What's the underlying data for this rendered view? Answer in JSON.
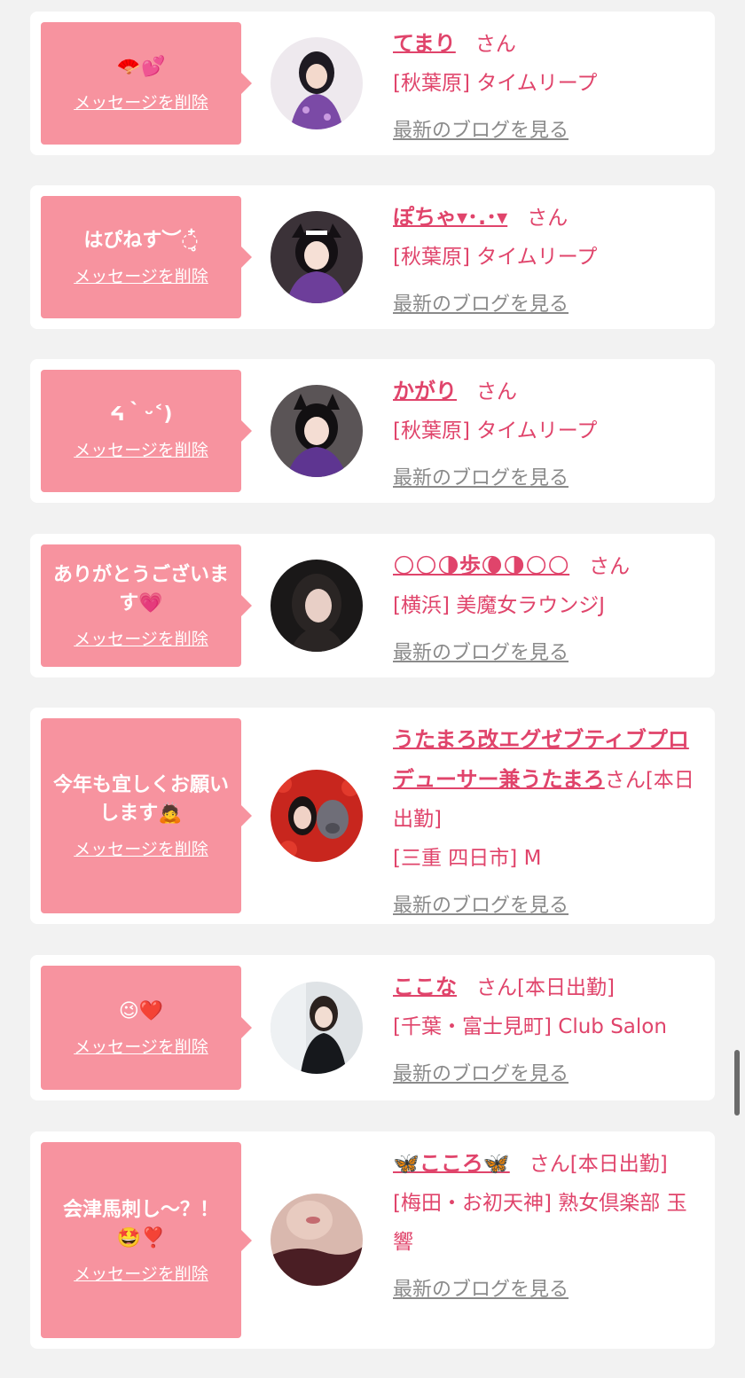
{
  "delete_label": "メッセージを削除",
  "blog_label": "最新のブログを見る",
  "colors": {
    "accent": "#e0446b",
    "bubble": "#f7939f",
    "link_gray": "#8a8a8a"
  },
  "items": [
    {
      "message": "🪭💕",
      "name": "てまり",
      "suffix": "さん",
      "shop": "[秋葉原] タイムリープ"
    },
    {
      "message": "はぴねす︶◌໋̥",
      "name": "ぽちゃ▾･.･▾",
      "suffix": "さん",
      "shop": "[秋葉原] タイムリープ"
    },
    {
      "message": "ᔦ｀ᵕ˂)",
      "name": "かがり",
      "suffix": "さん",
      "shop": "[秋葉原] タイムリープ"
    },
    {
      "message": "ありがとうございます💗",
      "name": "🌕🌕🌗歩🌘🌗🌕🌕",
      "suffix": "さん",
      "shop": "[横浜] 美魔女ラウンジJ"
    },
    {
      "message": "今年も宜しくお願いします🙇",
      "name": "うたまろ改エグゼブティブプロデューサー兼うたまろ",
      "suffix": "さん[本日出勤]",
      "shop": "[三重 四日市] M"
    },
    {
      "message": "😉❤️",
      "name": "ここな",
      "suffix": "さん[本日出勤]",
      "shop": "[千葉・富士見町] Club Salon"
    },
    {
      "message": "会津馬刺し〜？！🤩❣️",
      "name": "🦋こころ🦋",
      "suffix": "さん[本日出勤]",
      "shop": "[梅田・お初天神] 熟女倶楽部 玉響"
    }
  ]
}
